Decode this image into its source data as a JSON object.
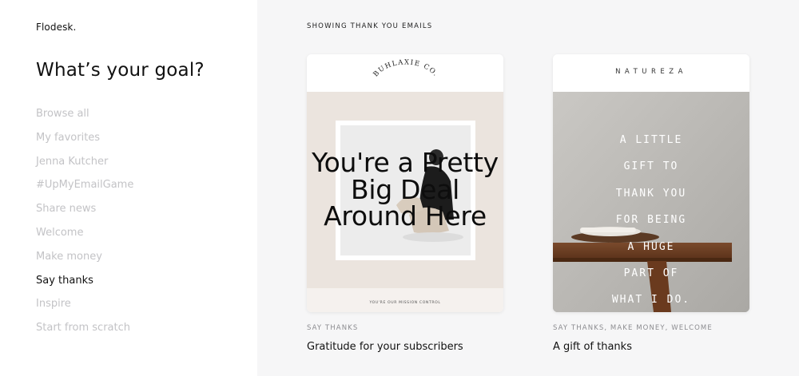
{
  "app": {
    "logo": "Flodesk."
  },
  "sidebar": {
    "title": "What’s your goal?",
    "items": [
      {
        "label": "Browse all",
        "active": false
      },
      {
        "label": "My favorites",
        "active": false
      },
      {
        "label": "Jenna Kutcher",
        "active": false
      },
      {
        "label": "#UpMyEmailGame",
        "active": false
      },
      {
        "label": "Share news",
        "active": false
      },
      {
        "label": "Welcome",
        "active": false
      },
      {
        "label": "Make money",
        "active": false
      },
      {
        "label": "Say thanks",
        "active": true
      },
      {
        "label": "Inspire",
        "active": false
      },
      {
        "label": "Start from scratch",
        "active": false
      }
    ]
  },
  "main": {
    "section_label": "SHOWING THANK YOU EMAILS",
    "cards": [
      {
        "brand": "BUHLAXIE CO.",
        "headline": "You're a Pretty Big Deal Around Here",
        "footer": "YOU'RE OUR MISSION CONTROL",
        "tags": "SAY THANKS",
        "title": "Gratitude for your subscribers"
      },
      {
        "brand": "NATUREZA",
        "body_lines": [
          "A LITTLE",
          "GIFT TO",
          "THANK YOU",
          "FOR BEING",
          "A HUGE",
          "PART OF",
          "WHAT I DO."
        ],
        "tags": "SAY THANKS, MAKE MONEY, WELCOME",
        "title": "A gift of thanks"
      }
    ]
  },
  "colors": {
    "sidebar_bg": "#ffffff",
    "main_bg": "#f6f6f7",
    "muted_text": "#c3c3c6",
    "active_text": "#111111",
    "card1_bg": "#ebe4de",
    "card2_bg": "#b7b5b1"
  }
}
